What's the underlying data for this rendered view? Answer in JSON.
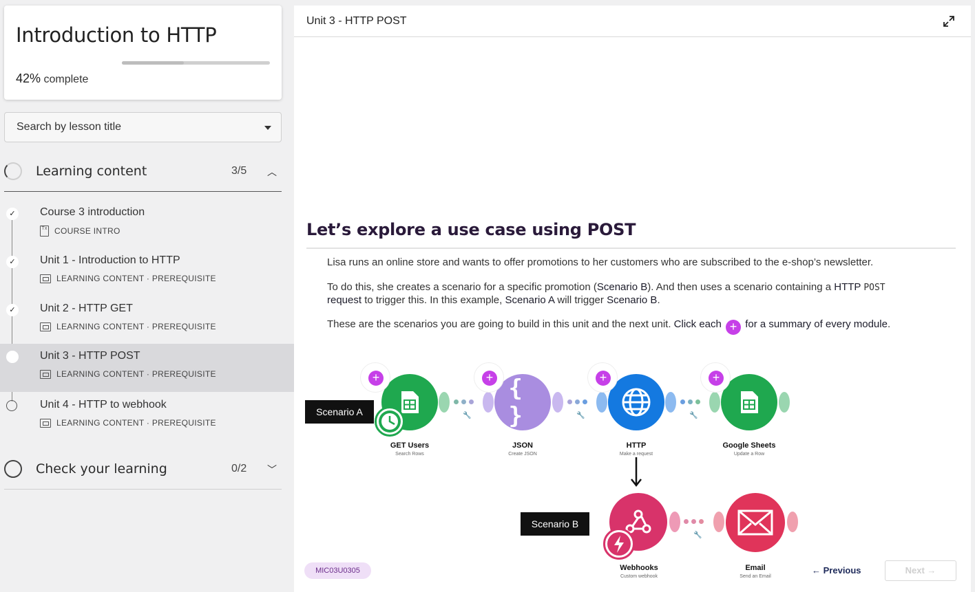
{
  "course": {
    "title": "Introduction to HTTP",
    "progress_percent": "42%",
    "progress_label": "complete",
    "progress_value": 0.42
  },
  "search": {
    "placeholder": "Search by lesson title"
  },
  "sections": [
    {
      "title": "Learning content",
      "count": "3/5",
      "expanded": true
    },
    {
      "title": "Check your learning",
      "count": "0/2",
      "expanded": false
    }
  ],
  "lessons": [
    {
      "title": "Course 3 introduction",
      "meta": "COURSE INTRO",
      "status": "done"
    },
    {
      "title": "Unit 1 - Introduction to HTTP",
      "meta": "LEARNING CONTENT · PREREQUISITE",
      "status": "done"
    },
    {
      "title": "Unit 2 - HTTP GET",
      "meta": "LEARNING CONTENT · PREREQUISITE",
      "status": "done"
    },
    {
      "title": "Unit 3 - HTTP POST",
      "meta": "LEARNING CONTENT · PREREQUISITE",
      "status": "current"
    },
    {
      "title": "Unit 4 - HTTP to webhook",
      "meta": "LEARNING CONTENT · PREREQUISITE",
      "status": "todo"
    }
  ],
  "main": {
    "header": "Unit 3 - HTTP POST",
    "heading": "Let’s explore a use case using POST",
    "para1": "Lisa runs an online store and wants to offer promotions to her customers who are subscribed to the e-shop’s newsletter.",
    "para2_a": "To do this, she creates a scenario for a specific promotion (",
    "para2_b": "Scenario B",
    "para2_c": "). And then uses a scenario containing a ",
    "para2_d": "HTTP",
    "para2_e": "POST",
    "para2_f": "request",
    "para2_g": " to trigger this. In this example, ",
    "para2_h": "Scenario A",
    "para2_i": " will trigger ",
    "para2_j": "Scenario B",
    "para2_k": ".",
    "para3_a": "These are the scenarios you are going to build in this unit and the next unit. ",
    "para3_b": "Click each",
    "para3_c": "for a summary of every module",
    "para3_d": "."
  },
  "diagram": {
    "scenario_a": "Scenario A",
    "scenario_b": "Scenario B",
    "modules": [
      {
        "name": "GET Users",
        "sub": "Search Rows",
        "color": "#1fa84f",
        "icon": "sheets-icon"
      },
      {
        "name": "JSON",
        "sub": "Create JSON",
        "color": "#a98de0",
        "icon": "json-icon"
      },
      {
        "name": "HTTP",
        "sub": "Make a request",
        "color": "#1479e0",
        "icon": "globe-icon"
      },
      {
        "name": "Google Sheets",
        "sub": "Update a Row",
        "color": "#1fa84f",
        "icon": "sheets-icon"
      },
      {
        "name": "Webhooks",
        "sub": "Custom webhook",
        "color": "#d8336a",
        "icon": "webhook-icon"
      },
      {
        "name": "Email",
        "sub": "Send an Email",
        "color": "#e0345a",
        "icon": "mail-icon"
      }
    ]
  },
  "footer": {
    "code": "MIC03U0305",
    "previous": "Previous",
    "next": "Next",
    "previous_arrow": "←",
    "next_arrow": "→"
  },
  "icons": {
    "check": "✓",
    "chevron_up": "︿",
    "chevron_down": "﹀",
    "plus": "+"
  }
}
